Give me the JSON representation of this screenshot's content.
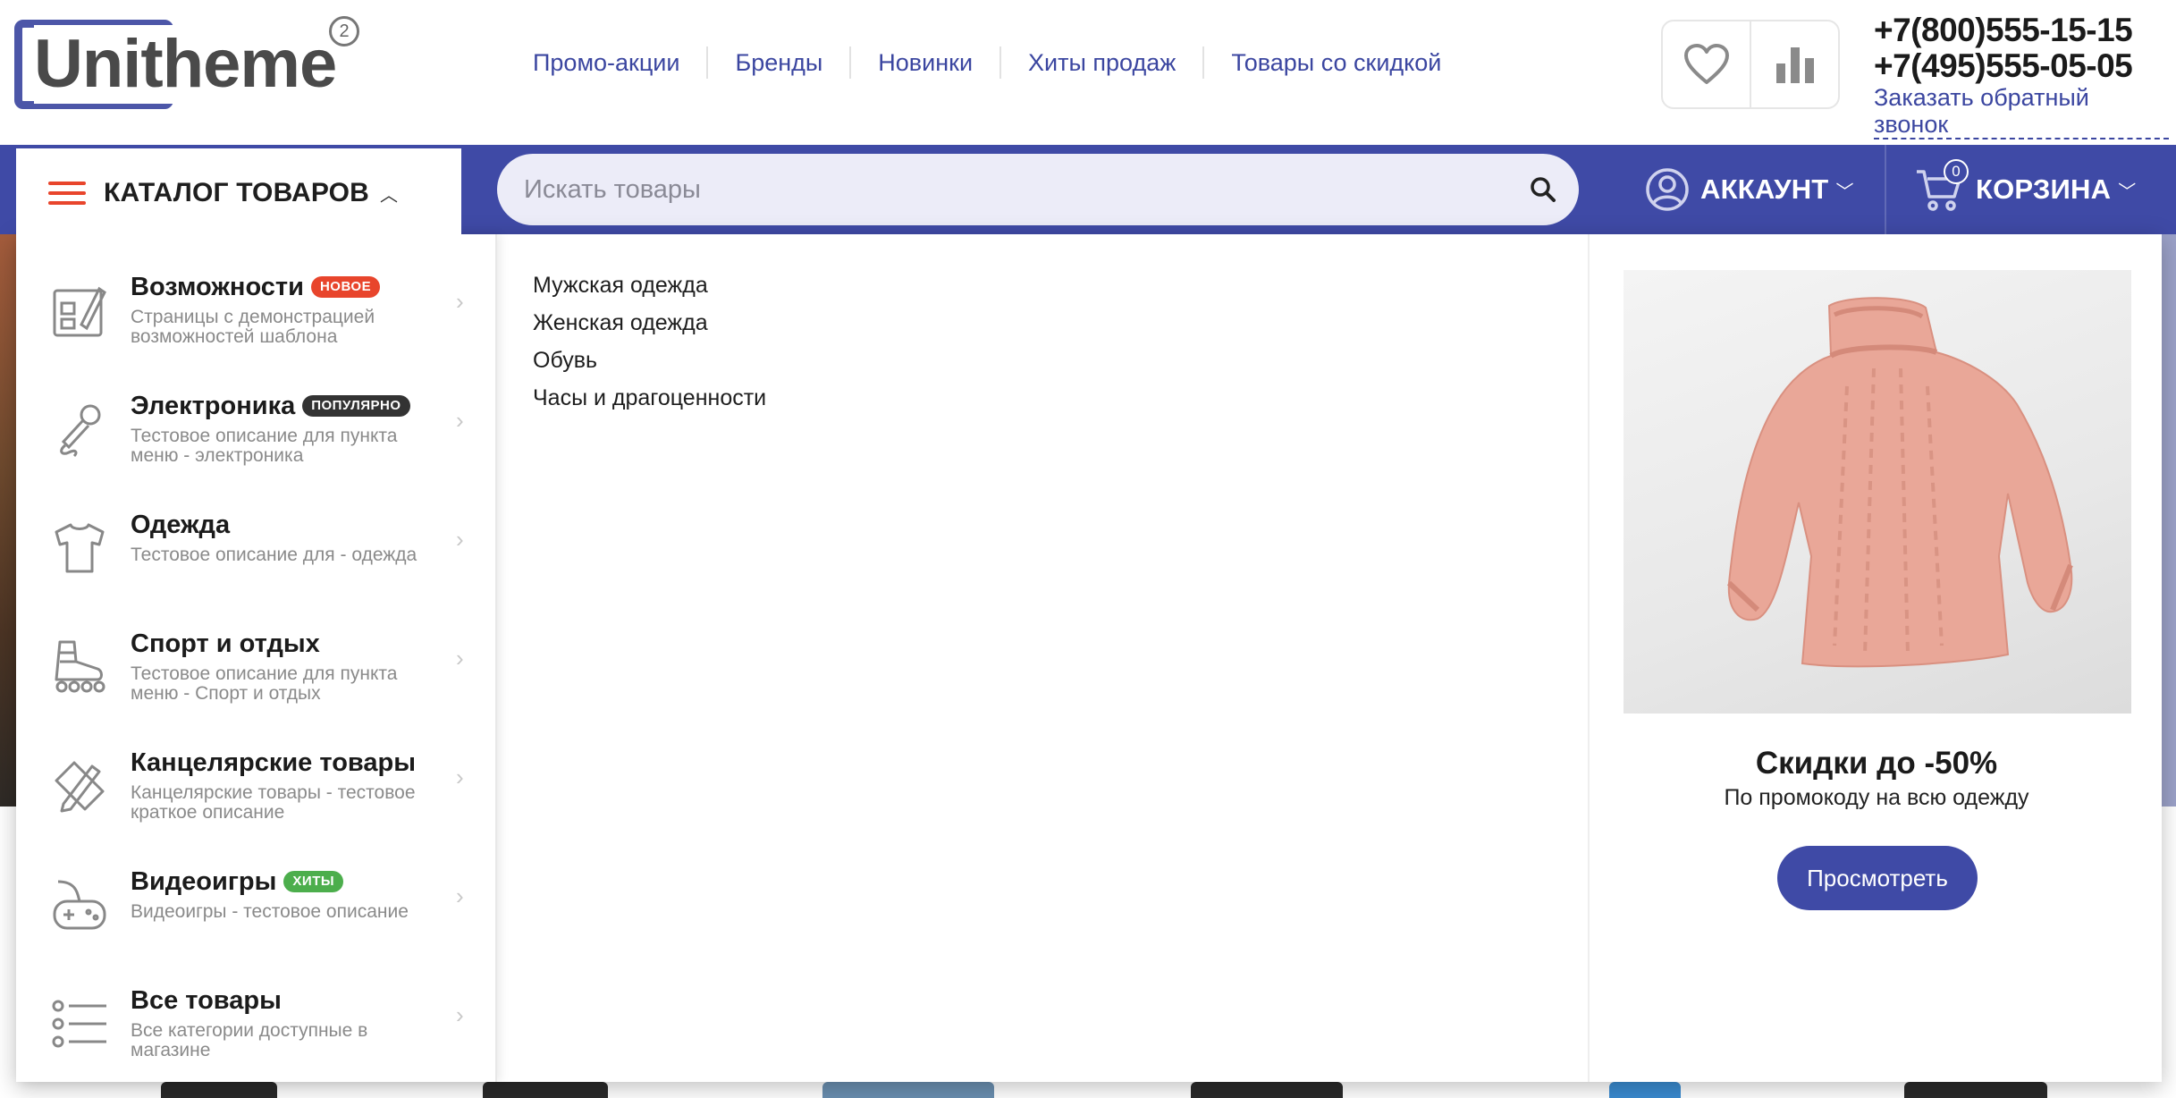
{
  "logo": {
    "text": "Unitheme",
    "version": "2"
  },
  "top_nav": [
    "Промо-акции",
    "Бренды",
    "Новинки",
    "Хиты продаж",
    "Товары со скидкой"
  ],
  "header_icons": [
    "heart-icon",
    "bar-chart-icon"
  ],
  "contacts": {
    "phone1": "+7(800)555-15-15",
    "phone2": "+7(495)555-05-05",
    "callback": "Заказать обратный звонок"
  },
  "catalog_button": {
    "label": "КАТАЛОГ ТОВАРОВ"
  },
  "search": {
    "placeholder": "Искать товары"
  },
  "account": {
    "label": "АККАУНТ"
  },
  "cart": {
    "label": "КОРЗИНА",
    "count": "0"
  },
  "categories": [
    {
      "title": "Возможности",
      "badge": "НОВОЕ",
      "badge_color": "#e8452c",
      "desc": "Страницы с демонстрацией возможностей шаблона",
      "icon": "layout-edit-icon"
    },
    {
      "title": "Электроника",
      "badge": "ПОПУЛЯРНО",
      "badge_color": "#333333",
      "desc": "Тестовое описание для пункта меню - электроника",
      "icon": "microphone-icon"
    },
    {
      "title": "Одежда",
      "badge": "",
      "badge_color": "",
      "desc": "Тестовое описание для - одежда",
      "icon": "tshirt-icon"
    },
    {
      "title": "Спорт и отдых",
      "badge": "",
      "badge_color": "",
      "desc": "Тестовое описание для пункта меню - Спорт и отдых",
      "icon": "rollerskate-icon"
    },
    {
      "title": "Канцелярские товары",
      "badge": "",
      "badge_color": "",
      "desc": "Канцелярские товары - тестовое краткое описание",
      "icon": "pencil-icon"
    },
    {
      "title": "Видеоигры",
      "badge": "ХИТЫ",
      "badge_color": "#4cae4c",
      "desc": "Видеоигры - тестовое описание",
      "icon": "gamepad-icon"
    },
    {
      "title": "Все товары",
      "badge": "",
      "badge_color": "",
      "desc": "Все категории доступные в магазине",
      "icon": "list-icon"
    }
  ],
  "subcategories": [
    "Мужская одежда",
    "Женская одежда",
    "Обувь",
    "Часы и драгоценности"
  ],
  "promo": {
    "title": "Скидки до -50%",
    "subtitle": "По промокоду на всю одежду",
    "button": "Просмотреть",
    "image": "pink-sweater-image"
  },
  "colors": {
    "brand_blue": "#3f4aa6",
    "accent_red": "#e8452c",
    "link_blue": "#3b46a0"
  }
}
